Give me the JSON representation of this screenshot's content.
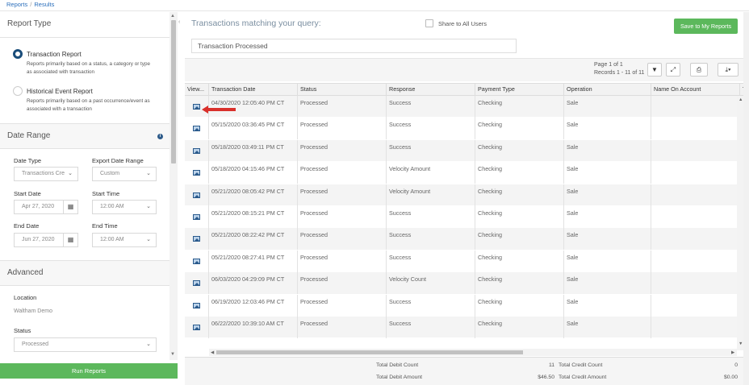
{
  "breadcrumb": {
    "root": "Reports",
    "separator": "/",
    "current": "Results"
  },
  "left": {
    "report_type": {
      "title": "Report Type",
      "options": [
        {
          "label": "Transaction Report",
          "desc1": "Reports primarily based on a status, a category or type",
          "desc2": "as associated with transaction",
          "selected": true
        },
        {
          "label": "Historical Event Report",
          "desc1": "Reports primarily based on a past occurrence/event as",
          "desc2": "associated with a transaction",
          "selected": false
        }
      ]
    },
    "date_range": {
      "title": "Date Range",
      "date_type_label": "Date Type",
      "date_type_value": "Transactions Cre",
      "export_range_label": "Export Date Range",
      "export_range_value": "Custom",
      "start_date_label": "Start Date",
      "start_date_value": "Apr 27, 2020",
      "start_time_label": "Start Time",
      "start_time_value": "12:00 AM",
      "end_date_label": "End Date",
      "end_date_value": "Jun 27, 2020",
      "end_time_label": "End Time",
      "end_time_value": "12:00 AM"
    },
    "advanced": {
      "title": "Advanced",
      "location_label": "Location",
      "location_value": "Waltham Demo",
      "status_label": "Status",
      "status_value": "Processed"
    },
    "run_button": "Run Reports"
  },
  "main": {
    "title": "Transactions matching your query:",
    "share_label": "Share to All Users",
    "save_button": "Save to My Reports",
    "query_text": "Transaction Processed",
    "page_info": "Page 1 of 1",
    "records_info": "Records 1 - 11 of 11",
    "columns": [
      "View...",
      "Transaction Date",
      "Status",
      "Response",
      "Payment Type",
      "Operation",
      "Name On Account",
      "T"
    ],
    "rows": [
      {
        "date": "04/30/2020 12:05:40 PM CT",
        "status": "Processed",
        "response": "Success",
        "payment": "Checking",
        "operation": "Sale"
      },
      {
        "date": "05/15/2020 03:36:45 PM CT",
        "status": "Processed",
        "response": "Success",
        "payment": "Checking",
        "operation": "Sale"
      },
      {
        "date": "05/18/2020 03:49:11 PM CT",
        "status": "Processed",
        "response": "Success",
        "payment": "Checking",
        "operation": "Sale"
      },
      {
        "date": "05/18/2020 04:15:46 PM CT",
        "status": "Processed",
        "response": "Velocity Amount",
        "payment": "Checking",
        "operation": "Sale"
      },
      {
        "date": "05/21/2020 08:05:42 PM CT",
        "status": "Processed",
        "response": "Velocity Amount",
        "payment": "Checking",
        "operation": "Sale"
      },
      {
        "date": "05/21/2020 08:15:21 PM CT",
        "status": "Processed",
        "response": "Success",
        "payment": "Checking",
        "operation": "Sale"
      },
      {
        "date": "05/21/2020 08:22:42 PM CT",
        "status": "Processed",
        "response": "Success",
        "payment": "Checking",
        "operation": "Sale"
      },
      {
        "date": "05/21/2020 08:27:41 PM CT",
        "status": "Processed",
        "response": "Success",
        "payment": "Checking",
        "operation": "Sale"
      },
      {
        "date": "06/03/2020 04:29:09 PM CT",
        "status": "Processed",
        "response": "Velocity Count",
        "payment": "Checking",
        "operation": "Sale"
      },
      {
        "date": "06/19/2020 12:03:46 PM CT",
        "status": "Processed",
        "response": "Success",
        "payment": "Checking",
        "operation": "Sale"
      },
      {
        "date": "06/22/2020 10:39:10 AM CT",
        "status": "Processed",
        "response": "Success",
        "payment": "Checking",
        "operation": "Sale"
      }
    ],
    "totals": {
      "debit_count_label": "Total Debit Count",
      "debit_count": "11",
      "credit_count_label": "Total Credit Count",
      "credit_count": "0",
      "debit_amount_label": "Total Debit Amount",
      "debit_amount": "$46.50",
      "credit_amount_label": "Total Credit Amount",
      "credit_amount": "$0.00"
    }
  },
  "icons": [
    "filter-icon",
    "expand-icon",
    "print-icon",
    "download-icon",
    "calendar-icon",
    "info-icon",
    "image-icon",
    "red-arrow-annotation"
  ],
  "colors": {
    "green": "#5cb85c",
    "radio_selected": "#1a4d7a",
    "link": "#2a6ebb",
    "arrow": "#d9302b"
  }
}
